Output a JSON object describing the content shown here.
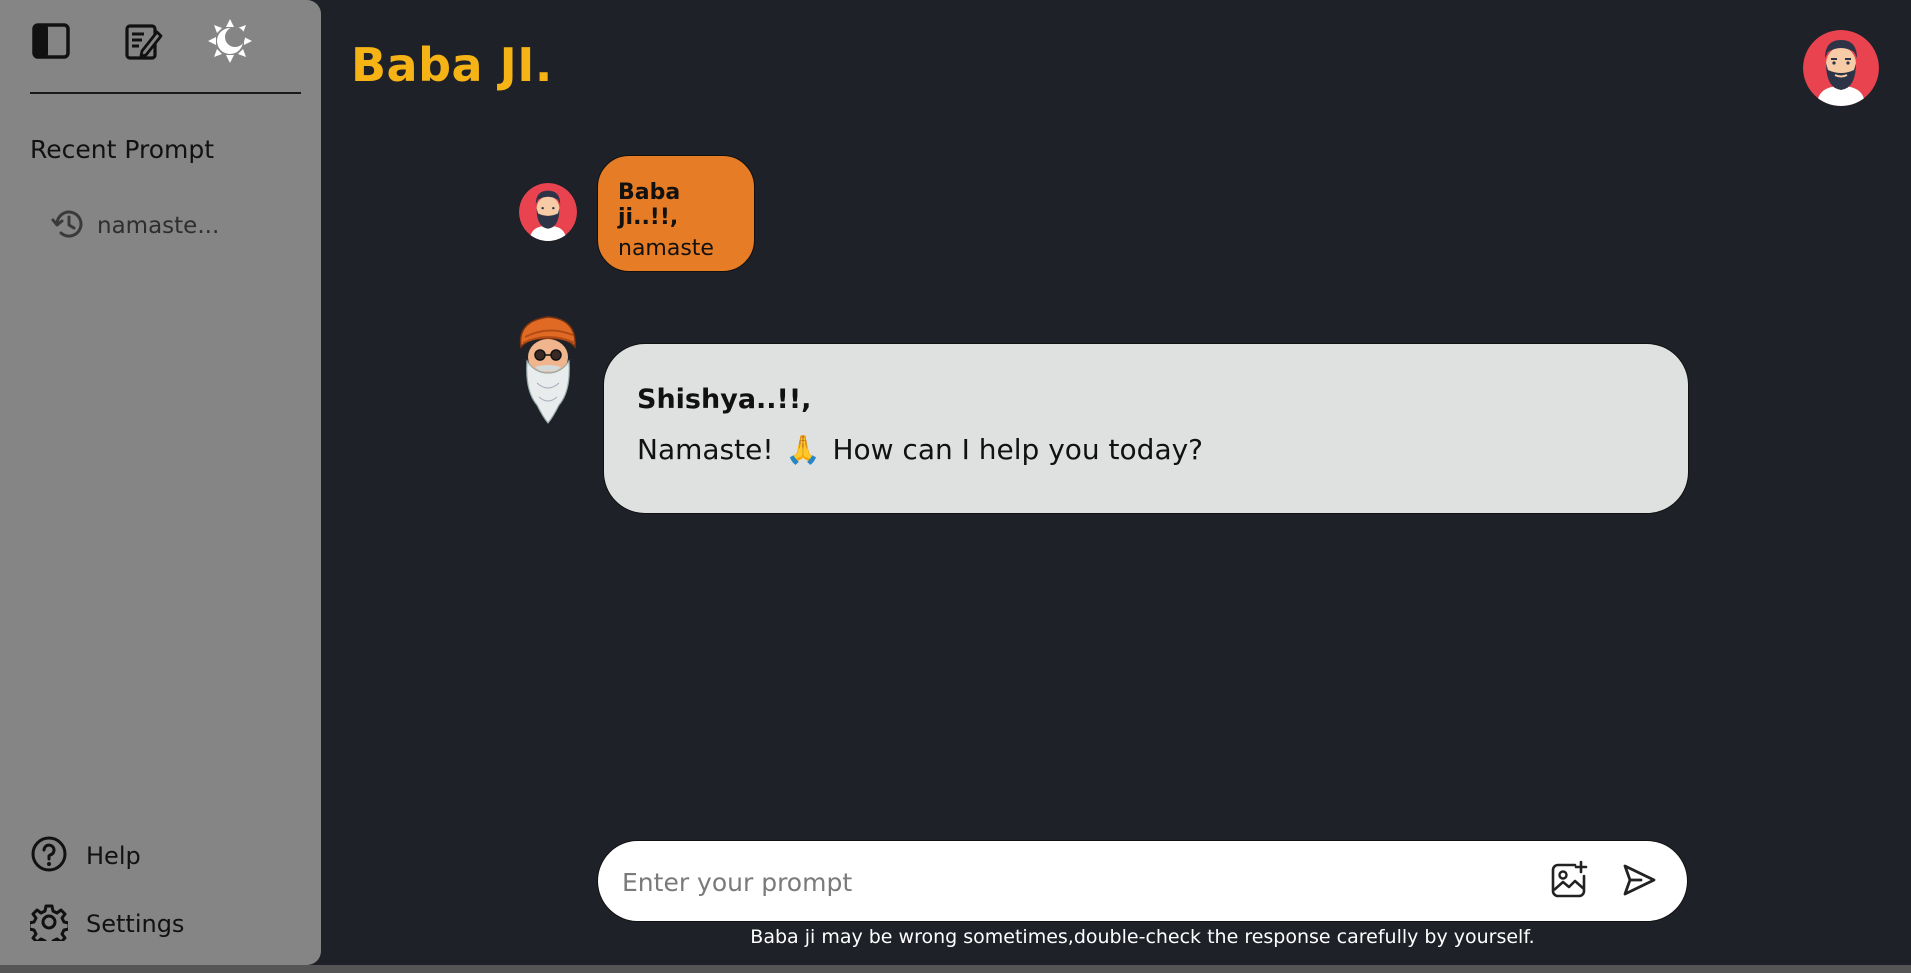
{
  "app": {
    "title": "Baba JI."
  },
  "sidebar": {
    "top_icons": [
      {
        "icon": "sidebar-toggle-icon"
      },
      {
        "icon": "new-chat-icon"
      },
      {
        "icon": "theme-toggle-icon"
      }
    ],
    "recent_title": "Recent Prompt",
    "recent_items": [
      {
        "label": "namaste...",
        "icon": "history-icon"
      }
    ],
    "help_label": "Help",
    "settings_label": "Settings"
  },
  "chat": {
    "messages": [
      {
        "role": "user",
        "sender": "Baba ji..!!,",
        "text": "namaste"
      },
      {
        "role": "assistant",
        "sender": "Shishya..!!,",
        "text_before": "Namaste!",
        "emoji": "🙏",
        "text_after": "How can I help you today?"
      }
    ]
  },
  "composer": {
    "placeholder": "Enter your prompt",
    "value": "",
    "disclaimer": "Baba ji may be wrong sometimes,double-check the response carefully by yourself."
  },
  "colors": {
    "background": "#1e2128",
    "sidebar": "#858585",
    "title_accent": "#f5b316",
    "user_bubble": "#e67c25",
    "bot_bubble": "#dfe0e0"
  }
}
